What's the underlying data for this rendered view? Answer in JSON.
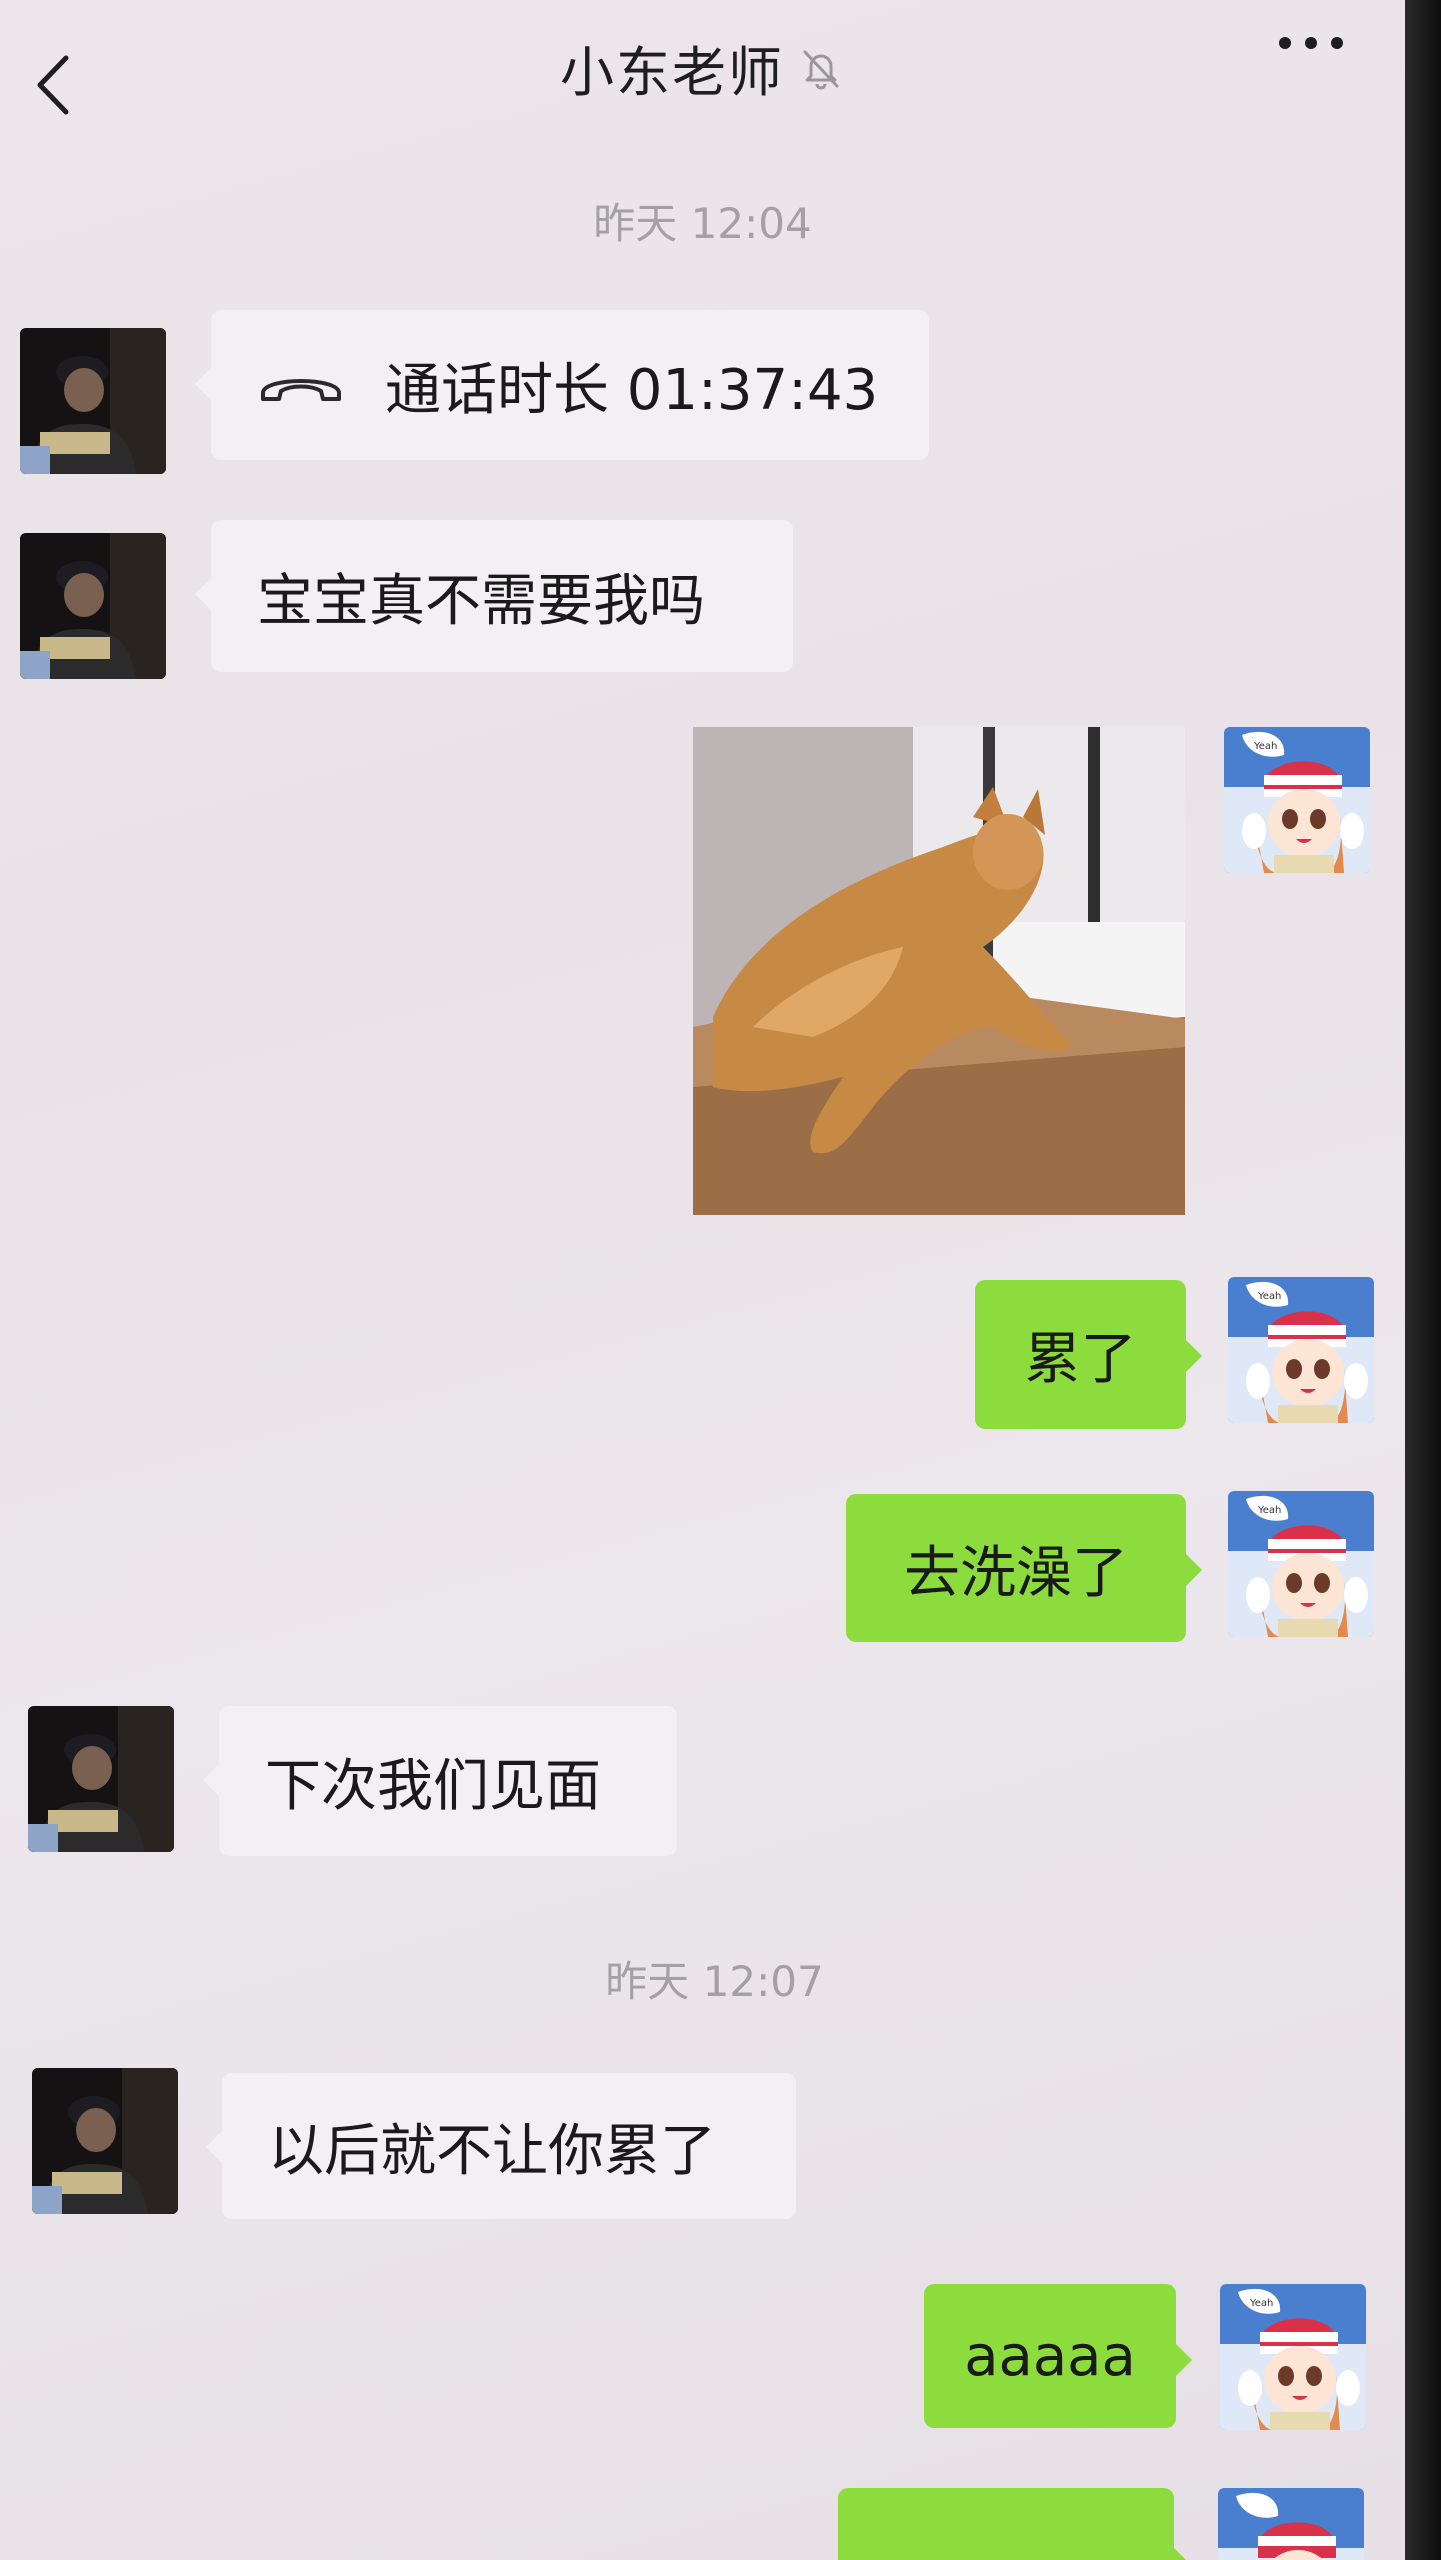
{
  "header": {
    "title": "小东老师",
    "back_icon": "chevron-left-icon",
    "mute_icon": "bell-off-icon",
    "more_icon": "more-dots-icon"
  },
  "timestamps": [
    "昨天 12:04",
    "昨天 12:07"
  ],
  "messages": [
    {
      "side": "left",
      "type": "call",
      "icon": "phone-hangup-icon",
      "text": "通话时长 01:37:43"
    },
    {
      "side": "left",
      "type": "text",
      "text": "宝宝真不需要我吗"
    },
    {
      "side": "right",
      "type": "image",
      "description_icon": "cat-photo"
    },
    {
      "side": "right",
      "type": "text",
      "text": "累了"
    },
    {
      "side": "right",
      "type": "text",
      "text": "去洗澡了"
    },
    {
      "side": "left",
      "type": "text",
      "text": "下次我们见面"
    },
    {
      "side": "left",
      "type": "text",
      "text": "以后就不让你累了"
    },
    {
      "side": "right",
      "type": "text",
      "text": "aaaaa"
    },
    {
      "side": "right",
      "type": "text",
      "text": ""
    }
  ],
  "colors": {
    "background": "#ebe5ea",
    "bubble_left": "#f3f0f3",
    "bubble_right": "#8ddc3d",
    "timestamp_text": "#a5a0a5"
  }
}
